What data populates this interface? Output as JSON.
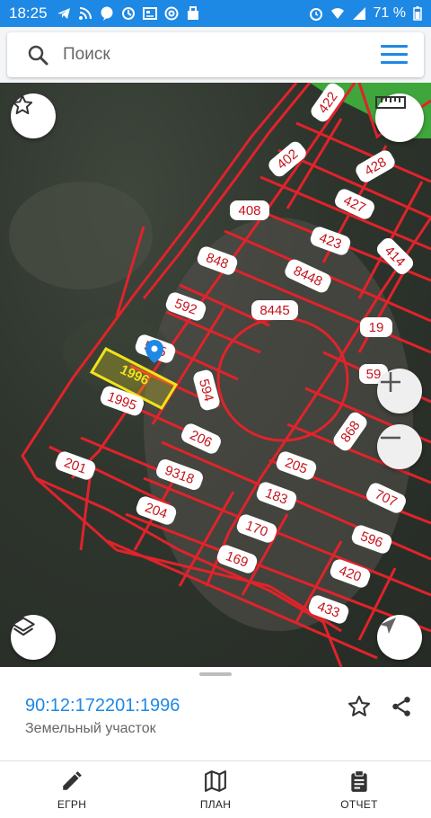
{
  "status_bar": {
    "time": "18:25",
    "battery": "71 %",
    "left_icons": [
      "telegram-icon",
      "rss-icon",
      "chat-icon",
      "sync-icon",
      "news-icon",
      "at-icon",
      "bag-icon"
    ],
    "right_icons": [
      "alarm-icon",
      "wifi-icon",
      "signal-icon",
      "battery-icon"
    ]
  },
  "search": {
    "placeholder": "Поиск"
  },
  "map": {
    "parcel_labels": [
      "422",
      "428",
      "427",
      "402",
      "408",
      "423",
      "414",
      "848",
      "8448",
      "8445",
      "592",
      "19",
      "595",
      "59",
      "1996",
      "594",
      "1995",
      "868",
      "206",
      "205",
      "201",
      "9318",
      "183",
      "707",
      "204",
      "170",
      "596",
      "169",
      "420",
      "433"
    ],
    "selected_parcel": "1996",
    "boundary_color": "#e0232b",
    "selected_color": "#f2e21a",
    "green_area_color": "#3ea63a"
  },
  "selection": {
    "cadastral_number": "90:12:172201:1996",
    "object_type": "Земельный участок"
  },
  "bottom_nav": {
    "items": [
      {
        "label": "ЕГРН",
        "icon": "pencil-icon"
      },
      {
        "label": "ПЛАН",
        "icon": "map-icon"
      },
      {
        "label": "ОТЧЕТ",
        "icon": "clipboard-icon"
      }
    ]
  }
}
